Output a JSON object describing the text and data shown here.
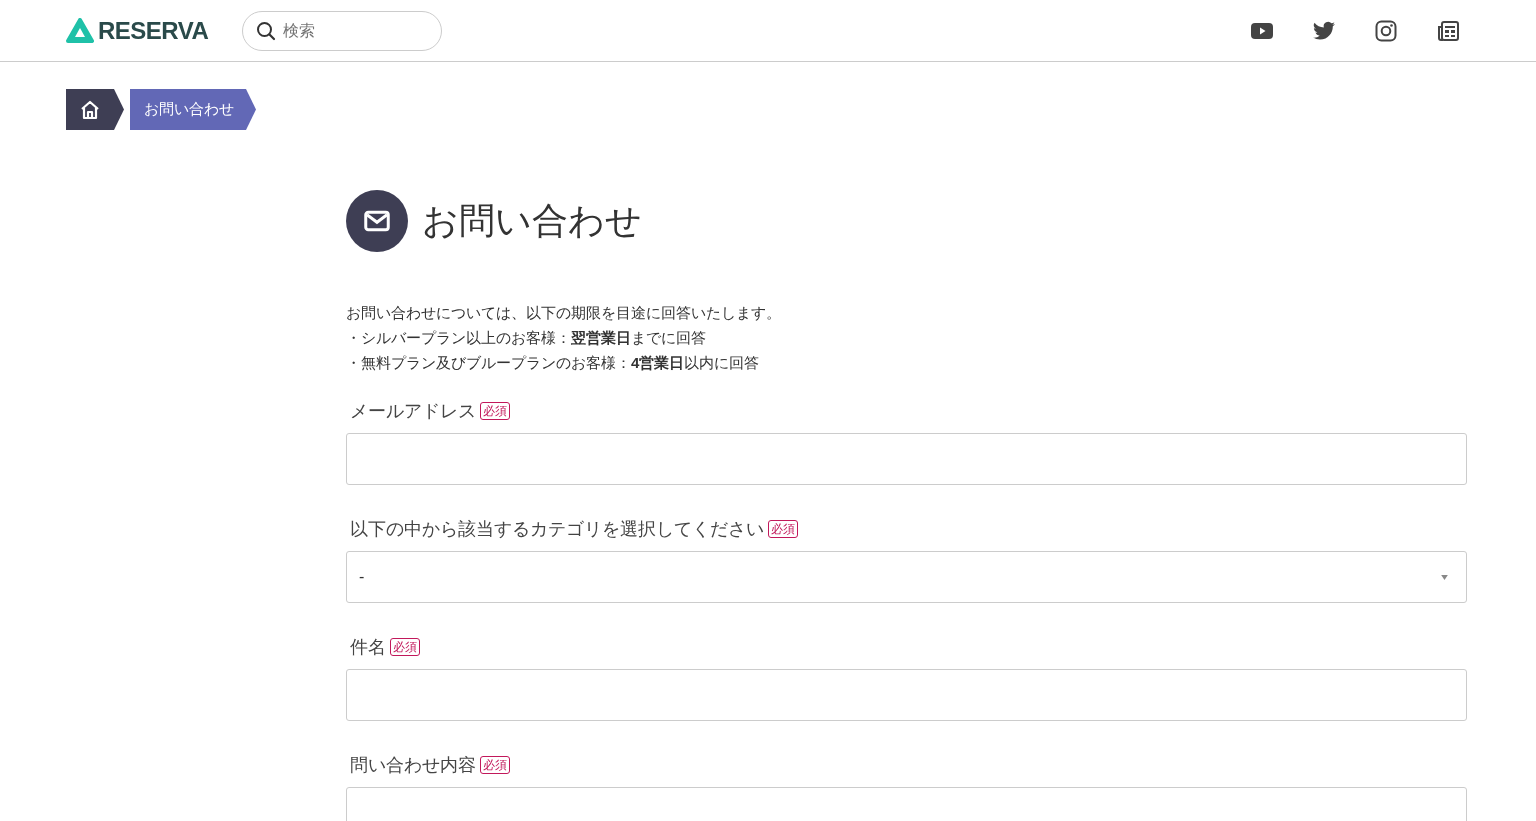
{
  "header": {
    "logo": "RESERVA",
    "search": {
      "placeholder": "検索"
    }
  },
  "breadcrumb": [
    {
      "kind": "home"
    },
    {
      "kind": "text",
      "label": "お問い合わせ"
    }
  ],
  "page_title": "お問い合わせ",
  "intro": [
    "お問い合わせについては、以下の期限を目途に回答いたします。",
    "・シルバープラン以上のお客様：**翌営業日**までに回答",
    "・無料プラン及びブループランのお客様：**4営業日**以内に回答"
  ],
  "fields": [
    {
      "kind": "input",
      "label": "メールアドレス",
      "badge": "必須"
    },
    {
      "kind": "select",
      "label": "以下の中から該当するカテゴリを選択してください",
      "badge": "必須",
      "value": "-"
    },
    {
      "kind": "input",
      "label": "件名",
      "badge": "必須"
    },
    {
      "kind": "textarea",
      "label": "問い合わせ内容",
      "badge": "必須"
    }
  ]
}
